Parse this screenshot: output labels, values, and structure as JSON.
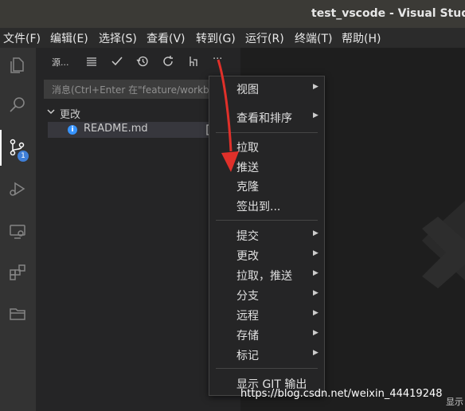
{
  "window": {
    "title": "test_vscode - Visual Studio"
  },
  "menubar": [
    "文件(F)",
    "编辑(E)",
    "选择(S)",
    "查看(V)",
    "转到(G)",
    "运行(R)",
    "终端(T)",
    "帮助(H)"
  ],
  "activity": {
    "scm_badge": "1"
  },
  "sidebar": {
    "title": "源...",
    "more": "···",
    "message_placeholder": "消息(Ctrl+Enter 在\"feature/workb",
    "changes_label": "更改",
    "file": {
      "name": "README.md",
      "status": "i"
    }
  },
  "context_menu": {
    "items": [
      {
        "label": "视图",
        "submenu": true
      },
      {
        "label": "查看和排序",
        "submenu": true
      },
      {
        "label": "拉取",
        "submenu": false
      },
      {
        "label": "推送",
        "submenu": false
      },
      {
        "label": "克隆",
        "submenu": false
      },
      {
        "label": "签出到...",
        "submenu": false
      },
      {
        "label": "提交",
        "submenu": true
      },
      {
        "label": "更改",
        "submenu": true
      },
      {
        "label": "拉取，推送",
        "submenu": true
      },
      {
        "label": "分支",
        "submenu": true
      },
      {
        "label": "远程",
        "submenu": true
      },
      {
        "label": "存储",
        "submenu": true
      },
      {
        "label": "标记",
        "submenu": true
      },
      {
        "label": "显示 GIT 输出",
        "submenu": false
      }
    ]
  },
  "watermark": "https://blog.csdn.net/weixin_44419248",
  "corner_text": "显示",
  "colors": {
    "arrow": "#e0302a",
    "accent": "#3794ff"
  }
}
